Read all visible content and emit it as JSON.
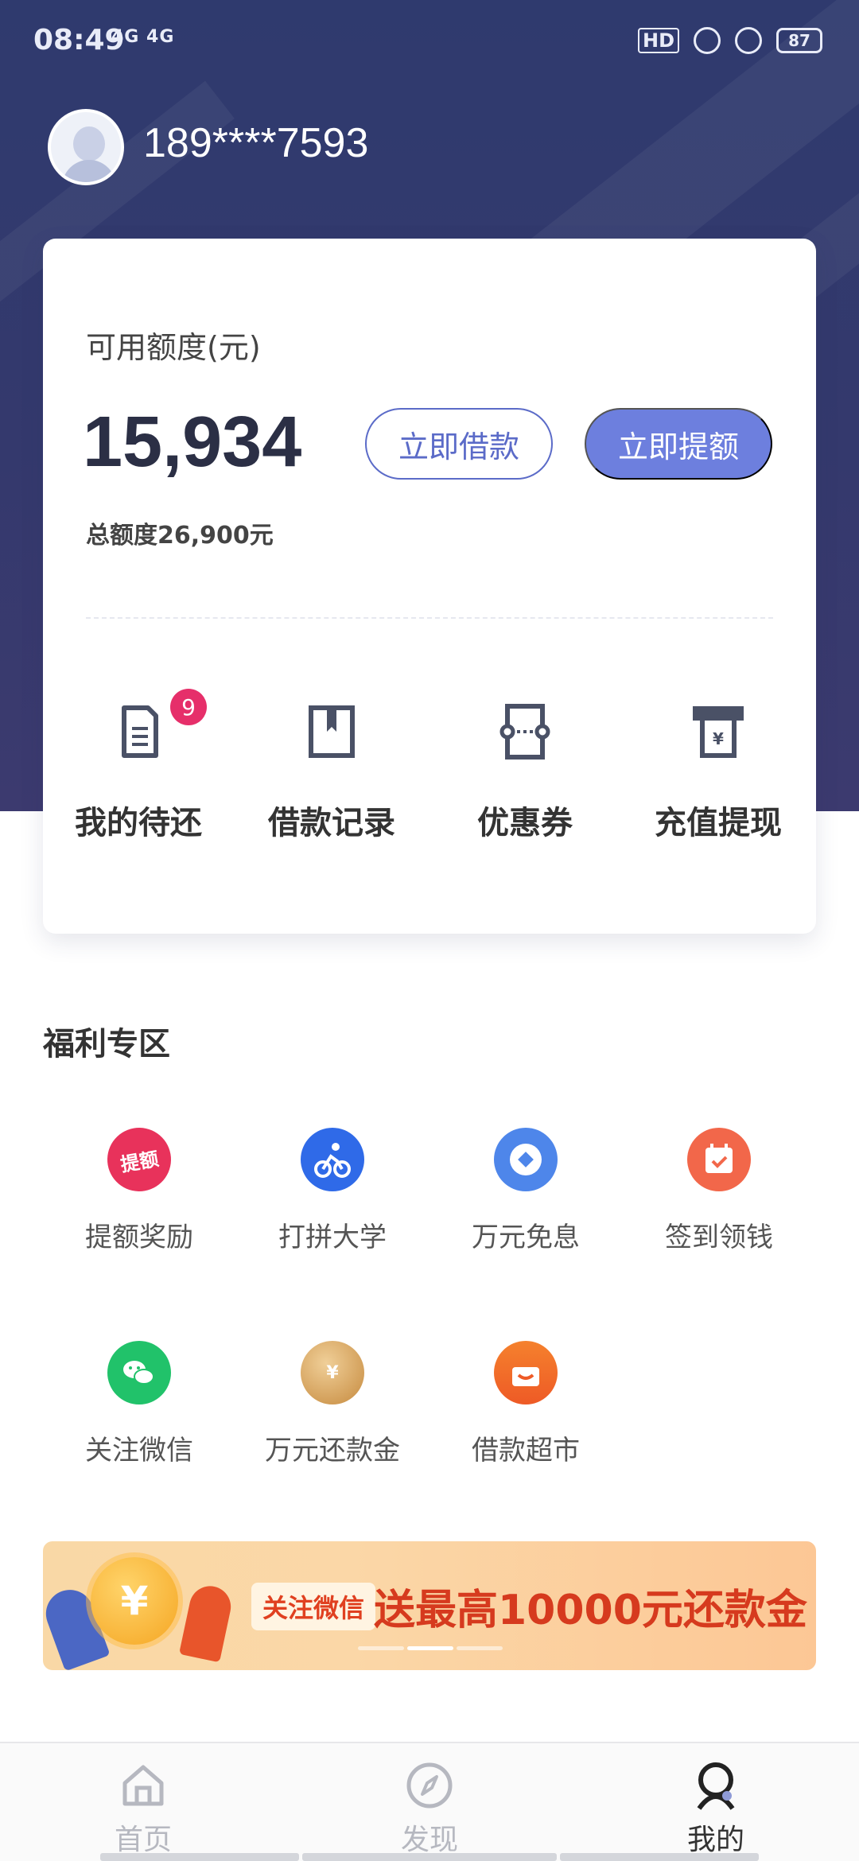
{
  "status_bar": {
    "time": "08:49",
    "network": "4G 4G",
    "hd": "HD",
    "battery": "87"
  },
  "user": {
    "phone": "189****7593"
  },
  "credit": {
    "label": "可用额度(元)",
    "available": "15,934",
    "total": "总额度26,900元",
    "borrow_button": "立即借款",
    "raise_button": "立即提额"
  },
  "quick_actions": [
    {
      "label": "我的待还",
      "icon": "bill-icon",
      "badge": "9"
    },
    {
      "label": "借款记录",
      "icon": "bookmark-record-icon"
    },
    {
      "label": "优惠券",
      "icon": "coupon-icon"
    },
    {
      "label": "充值提现",
      "icon": "atm-withdraw-icon"
    }
  ],
  "welfare": {
    "title": "福利专区",
    "items": [
      {
        "label": "提额奖励",
        "icon": "raise-reward-icon",
        "icon_text": "提额",
        "color": "#e8325b"
      },
      {
        "label": "打拼大学",
        "icon": "cyclist-icon",
        "color": "#2f6ae8"
      },
      {
        "label": "万元免息",
        "icon": "interest-free-icon",
        "color": "#4e86ea"
      },
      {
        "label": "签到领钱",
        "icon": "checkin-calendar-icon",
        "color": "#f2674a"
      },
      {
        "label": "关注微信",
        "icon": "wechat-icon",
        "color": "#21c26a"
      },
      {
        "label": "万元还款金",
        "icon": "gold-coin-icon",
        "icon_text": "¥",
        "color": "#d8a25a"
      },
      {
        "label": "借款超市",
        "icon": "shopping-bag-icon",
        "color": "#f16a2a"
      }
    ]
  },
  "banner": {
    "tag": "关注微信",
    "headline": "送最高10000元还款金",
    "coin_symbol": "¥"
  },
  "tabbar": [
    {
      "label": "首页",
      "icon": "home-icon",
      "active": false
    },
    {
      "label": "发现",
      "icon": "compass-icon",
      "active": false
    },
    {
      "label": "我的",
      "icon": "profile-icon",
      "active": true
    }
  ],
  "colors": {
    "hero": "#2f3a6e",
    "accent": "#6d7fde",
    "badge": "#e62f6a"
  }
}
